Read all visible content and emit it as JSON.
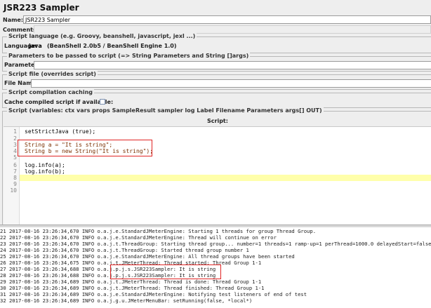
{
  "panel": {
    "title": "JSR223 Sampler"
  },
  "name": {
    "label": "Name:",
    "value": "JSR223 Sampler"
  },
  "comments": {
    "label": "Comments:"
  },
  "script_language": {
    "legend": "Script language (e.g. Groovy, beanshell, javascript, jexl ...)",
    "label": "Language:",
    "value": "java",
    "engine": "(BeanShell 2.0b5 / BeanShell Engine 1.0)"
  },
  "parameters": {
    "legend": "Parameters to be passed to script (=> String Parameters and String []args)",
    "label": "Parameters:"
  },
  "script_file": {
    "legend": "Script file (overrides script)",
    "label": "File Name:"
  },
  "caching": {
    "legend": "Script compilation caching",
    "label": "Cache compiled script if available:"
  },
  "script": {
    "legend": "Script (variables: ctx vars props SampleResult sampler log Label Filename Parameters args[] OUT)",
    "header": "Script:",
    "line_numbers": [
      "1",
      "2",
      "3",
      "4",
      "5",
      "6",
      "7",
      "8",
      "9",
      "10"
    ],
    "lines": [
      "setStrictJava (true);",
      "",
      "String a = \"It is string\";",
      "String b = new String(\"It is string\");",
      "",
      "log.info(a);",
      "log.info(b);",
      "",
      "",
      ""
    ]
  },
  "log": {
    "lines": [
      "21 2017-08-16 23:26:34,670 INFO o.a.j.e.StandardJMeterEngine: Starting 1 threads for group Thread Group.",
      "22 2017-08-16 23:26:34,670 INFO o.a.j.e.StandardJMeterEngine: Thread will continue on error",
      "23 2017-08-16 23:26:34,670 INFO o.a.j.t.ThreadGroup: Starting thread group... number=1 threads=1 ramp-up=1 perThread=1000.0 delayedStart=false",
      "24 2017-08-16 23:26:34,670 INFO o.a.j.t.ThreadGroup: Started thread group number 1",
      "25 2017-08-16 23:26:34,670 INFO o.a.j.e.StandardJMeterEngine: All thread groups have been started",
      "26 2017-08-16 23:26:34,675 INFO o.a.j.t.JMeterThread: Thread started: Thread Group 1-1",
      "27 2017-08-16 23:26:34,688 INFO o.a.j.p.j.s.JSR223Sampler: It is string",
      "28 2017-08-16 23:26:34,688 INFO o.a.j.p.j.s.JSR223Sampler: It is string",
      "29 2017-08-16 23:26:34,689 INFO o.a.j.t.JMeterThread: Thread is done: Thread Group 1-1",
      "30 2017-08-16 23:26:34,689 INFO o.a.j.t.JMeterThread: Thread finished: Thread Group 1-1",
      "31 2017-08-16 23:26:34,689 INFO o.a.j.e.StandardJMeterEngine: Notifying test listeners of end of test",
      "32 2017-08-16 23:26:34,689 INFO o.a.j.g.u.JMeterMenuBar: setRunning(false, *local*)"
    ]
  },
  "colors": {
    "annotation_box": "#e02424",
    "current_line": "#ffffaa"
  }
}
